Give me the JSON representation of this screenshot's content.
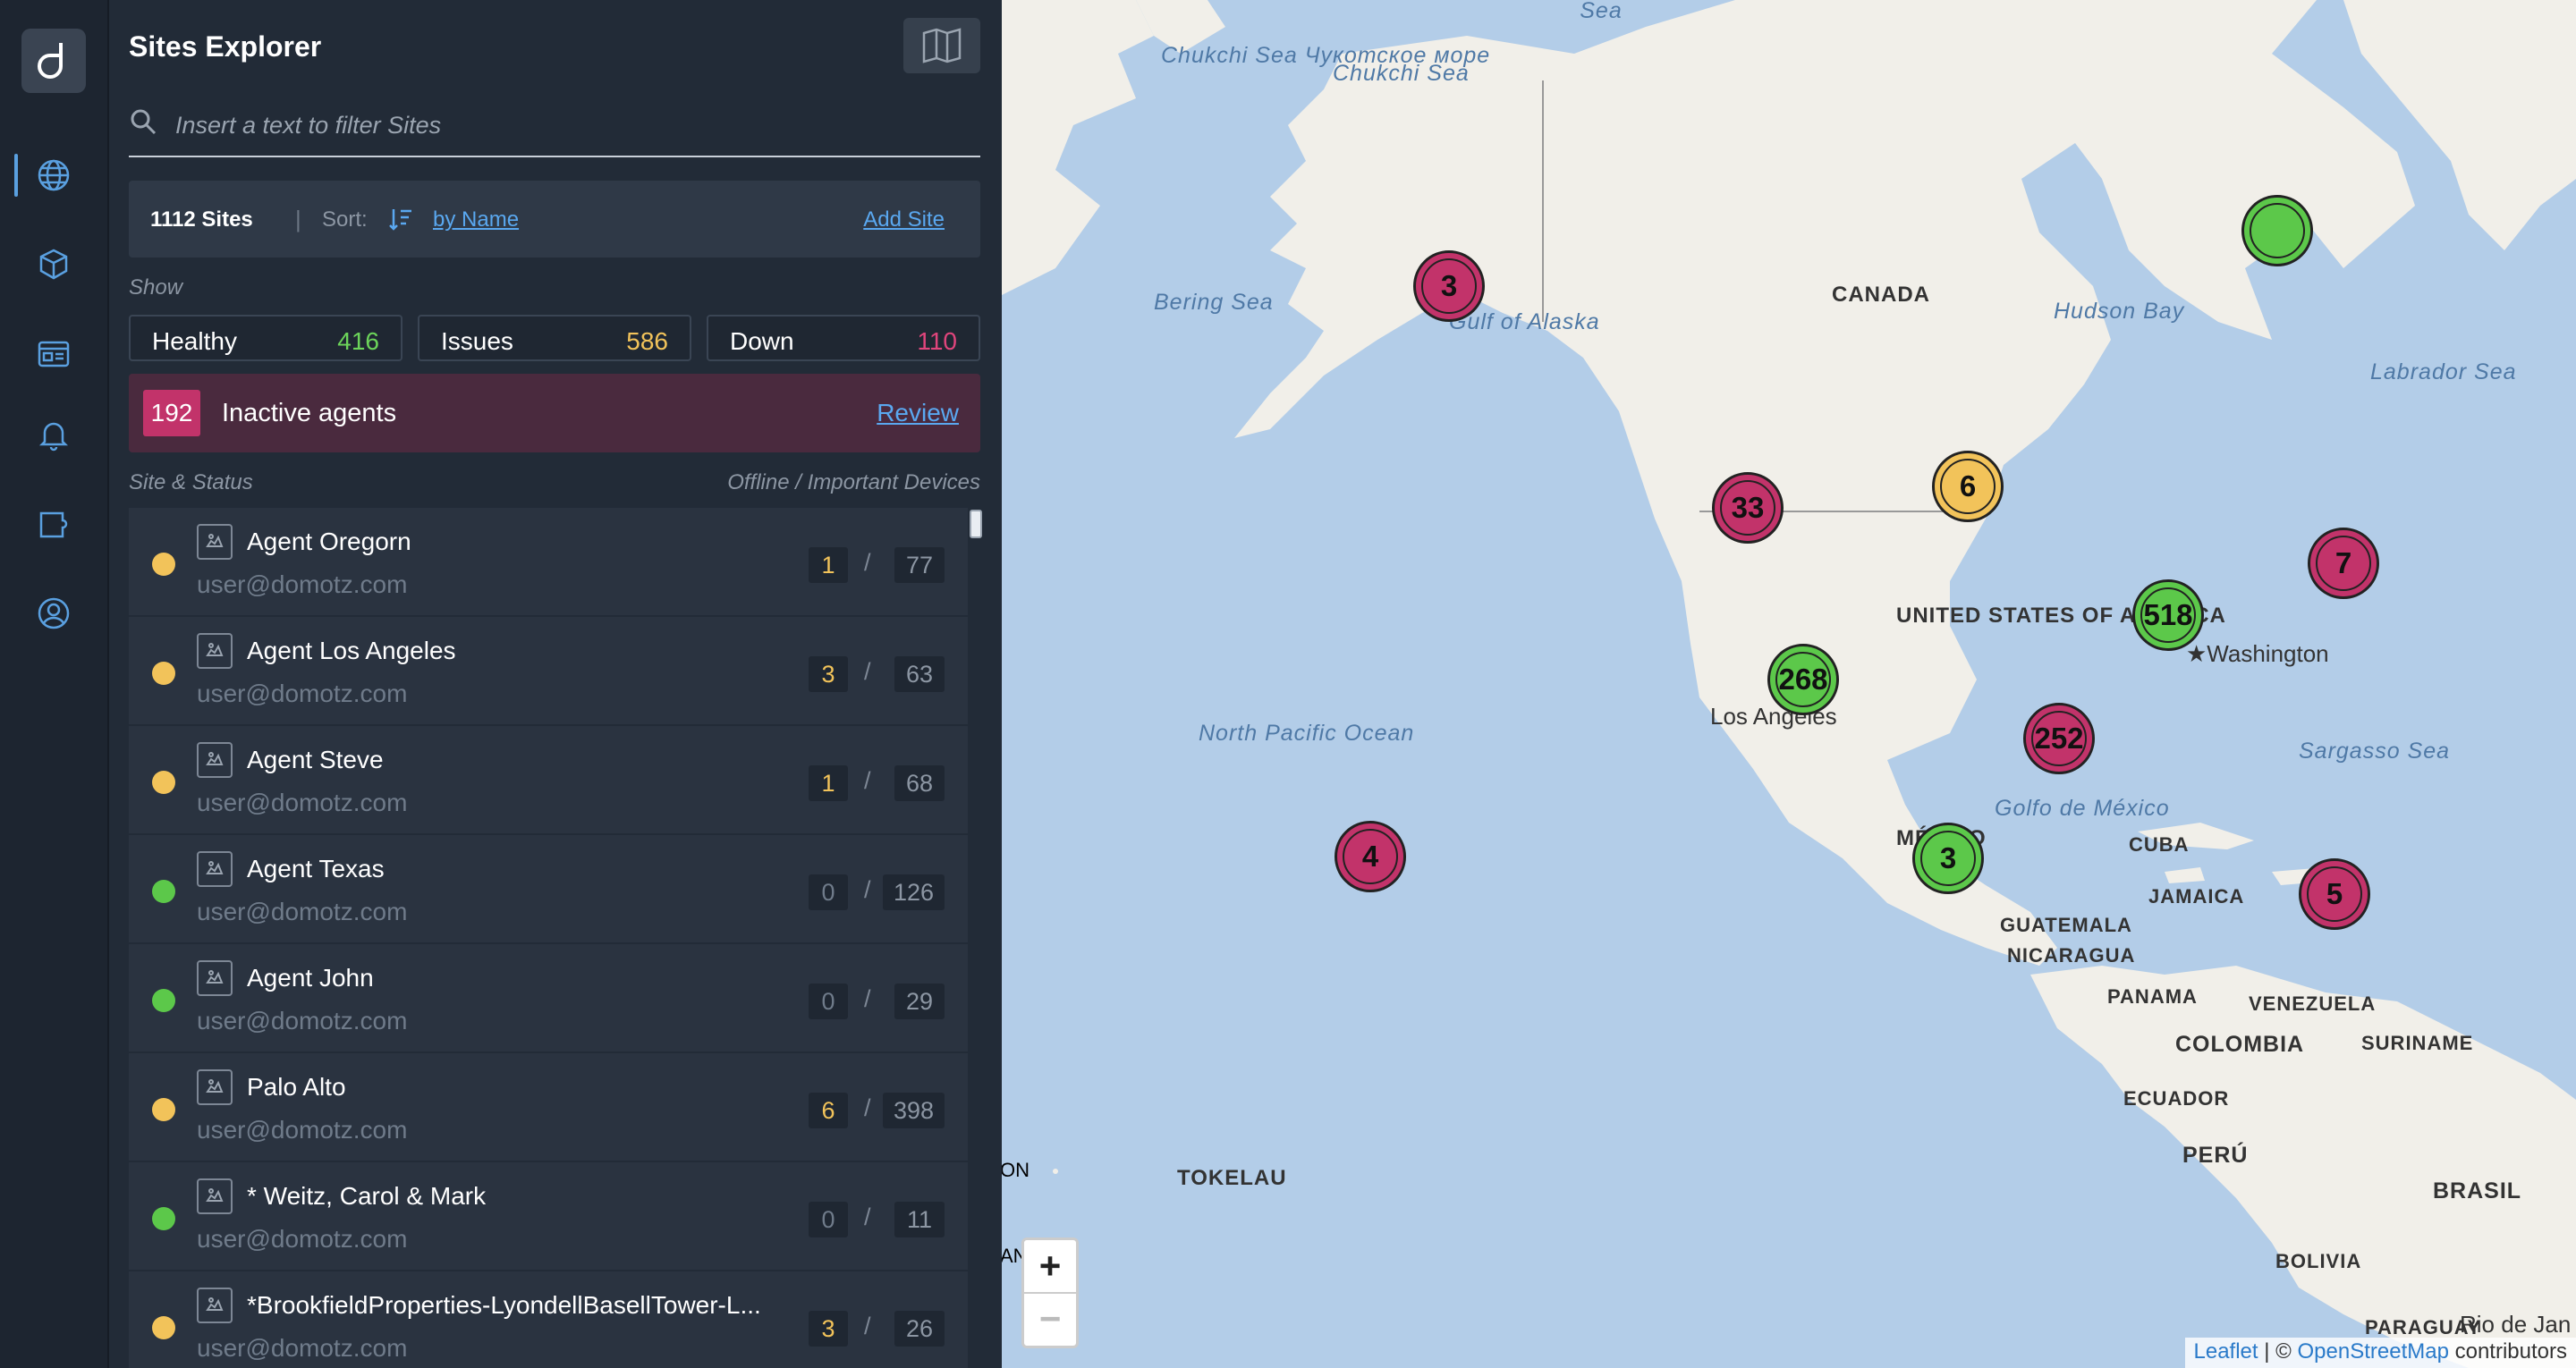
{
  "app": {
    "title": "Sites Explorer"
  },
  "search": {
    "placeholder": "Insert a text to filter Sites"
  },
  "summary": {
    "count": "1112 Sites",
    "separator": "|",
    "sort_label": "Sort:",
    "sort_value": "by Name",
    "add_site": "Add Site"
  },
  "show": {
    "label": "Show"
  },
  "filters": [
    {
      "label": "Healthy",
      "value": "416",
      "color": "#6cd45a"
    },
    {
      "label": "Issues",
      "value": "586",
      "color": "#f2c35a"
    },
    {
      "label": "Down",
      "value": "110",
      "color": "#e0457c"
    }
  ],
  "inactive": {
    "count": "192",
    "label": "Inactive agents",
    "action": "Review"
  },
  "columns": {
    "left": "Site & Status",
    "right": "Offline / Important Devices"
  },
  "sites": [
    {
      "name": "Agent Oregorn",
      "email": "user@domotz.com",
      "offline": "1",
      "important": "77",
      "status": "issues"
    },
    {
      "name": "Agent Los Angeles",
      "email": "user@domotz.com",
      "offline": "3",
      "important": "63",
      "status": "issues"
    },
    {
      "name": "Agent Steve",
      "email": "user@domotz.com",
      "offline": "1",
      "important": "68",
      "status": "issues"
    },
    {
      "name": "Agent Texas",
      "email": "user@domotz.com",
      "offline": "0",
      "important": "126",
      "status": "healthy"
    },
    {
      "name": "Agent John",
      "email": "user@domotz.com",
      "offline": "0",
      "important": "29",
      "status": "healthy"
    },
    {
      "name": "Palo Alto",
      "email": "user@domotz.com",
      "offline": "6",
      "important": "398",
      "status": "issues"
    },
    {
      "name": "* Weitz, Carol & Mark",
      "email": "user@domotz.com",
      "offline": "0",
      "important": "11",
      "status": "healthy"
    },
    {
      "name": "*BrookfieldProperties-LyondellBasellTower-L...",
      "email": "user@domotz.com",
      "offline": "3",
      "important": "26",
      "status": "issues"
    }
  ],
  "status_colors": {
    "healthy": "#5cc84a",
    "issues": "#f2c35a",
    "down": "#c2336a"
  },
  "map": {
    "clusters": [
      {
        "label": "3",
        "status": "down"
      },
      {
        "label": "",
        "status": "healthy"
      },
      {
        "label": "33",
        "status": "down"
      },
      {
        "label": "6",
        "status": "issues"
      },
      {
        "label": "7",
        "status": "down"
      },
      {
        "label": "518",
        "status": "healthy"
      },
      {
        "label": "268",
        "status": "healthy"
      },
      {
        "label": "252",
        "status": "down"
      },
      {
        "label": "4",
        "status": "down"
      },
      {
        "label": "3",
        "status": "healthy"
      },
      {
        "label": "5",
        "status": "down"
      }
    ],
    "labels": {
      "chukchi_sea_left": "Chukchi Sea Чукотское море",
      "chukchi_sea": "Chukchi Sea",
      "sea_top": "Sea",
      "bering_sea": "Bering Sea",
      "gulf_alaska": "Gulf of Alaska",
      "canada": "CANADA",
      "hudson_bay": "Hudson Bay",
      "labrador_sea": "Labrador Sea",
      "usa": "UNITED STATES OF AMERICA",
      "washington": "★Washington",
      "los_angeles": "Los Angeles",
      "north_pacific": "North Pacific Ocean",
      "sargasso_sea": "Sargasso Sea",
      "golfo_mexico": "Golfo de México",
      "mexico": "MÉXICO",
      "cuba": "CUBA",
      "jamaica": "JAMAICA",
      "guatemala": "GUATEMALA",
      "nicaragua": "NICARAGUA",
      "panama": "PANAMA",
      "venezuela": "VENEZUELA",
      "colombia": "COLOMBIA",
      "suriname": "SURINAME",
      "ecuador": "ECUADOR",
      "peru": "PERÚ",
      "brasil": "BRASIL",
      "bolivia": "BOLIVIA",
      "paraguay": "PARAGUAY",
      "rio": "Rio de Jan",
      "tokelau": "TOKELAU",
      "on": "ON",
      "an": "AN"
    },
    "zoom_in": "+",
    "zoom_out": "−",
    "attribution": {
      "leaflet": "Leaflet",
      "middle": " | © ",
      "osm": "OpenStreetMap",
      "suffix": " contributors"
    }
  }
}
